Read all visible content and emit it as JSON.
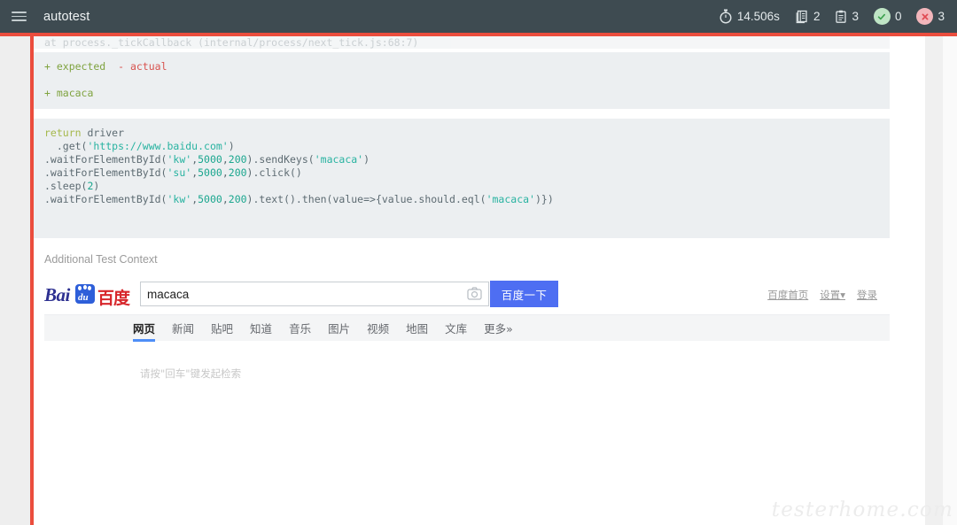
{
  "topbar": {
    "menu_icon": "hamburger-menu-icon",
    "title": "autotest",
    "stats": [
      {
        "icon": "stopwatch-icon",
        "value": "14.506s",
        "name": "duration-stat"
      },
      {
        "icon": "suites-icon",
        "value": "2",
        "name": "suites-stat"
      },
      {
        "icon": "tests-icon",
        "value": "3",
        "name": "tests-stat"
      },
      {
        "icon": "check-icon",
        "value": "0",
        "name": "passes-stat"
      },
      {
        "icon": "cross-icon",
        "value": "3",
        "name": "failures-stat"
      }
    ],
    "colors": {
      "bar_bg": "#3e4b51",
      "pass": "#bfe5c5",
      "fail": "#f3b6bb",
      "fail_rule": "#eb4d3d"
    }
  },
  "report": {
    "cut_line": "at process._tickCallback (internal/process/next_tick.js:68:7)",
    "diff_legend_added": "+ expected",
    "diff_legend_removed": "- actual",
    "diff_line": "+ macaca",
    "code": {
      "l1_kw": "return",
      "l1_rest": " driver",
      "l2_a": "  .get(",
      "l2_str": "'https://www.baidu.com'",
      "l2_b": ")",
      "l3_a": ".waitForElementById(",
      "l3_s1": "'kw'",
      "l3_c1": ",",
      "l3_n1": "5000",
      "l3_c2": ",",
      "l3_n2": "200",
      "l3_b": ").sendKeys(",
      "l3_s2": "'macaca'",
      "l3_c": ")",
      "l4_a": ".waitForElementById(",
      "l4_s1": "'su'",
      "l4_c1": ",",
      "l4_n1": "5000",
      "l4_c2": ",",
      "l4_n2": "200",
      "l4_b": ").click()",
      "l5_a": ".sleep(",
      "l5_n": "2",
      "l5_b": ")",
      "l6_a": ".waitForElementById(",
      "l6_s1": "'kw'",
      "l6_c1": ",",
      "l6_n1": "5000",
      "l6_c2": ",",
      "l6_n2": "200",
      "l6_b": ").text().then(value=>{value.should.eql(",
      "l6_s2": "'macaca'",
      "l6_c": ")})"
    },
    "context_label": "Additional Test Context"
  },
  "baidu": {
    "logo": {
      "bai": "Bai",
      "du": "du",
      "cn": "百度",
      "paw_icon": "paw-print-icon"
    },
    "search_value": "macaca",
    "search_placeholder": "",
    "camera_icon": "camera-icon",
    "search_button": "百度一下",
    "user_links": [
      "百度首页",
      "设置▾",
      "登录"
    ],
    "tabs": [
      "网页",
      "新闻",
      "贴吧",
      "知道",
      "音乐",
      "图片",
      "视频",
      "地图",
      "文库",
      "更多»"
    ],
    "active_tab_index": 0,
    "hint": "请按\"回车\"键发起检索",
    "colors": {
      "button": "#4e6ef2",
      "active_underline": "#4e8ef7",
      "logo_red": "#d7262b",
      "logo_blue": "#2e3191"
    }
  },
  "watermark": {
    "text": "testerhome.com"
  },
  "scrollbar": {
    "name": "vertical-scrollbar"
  }
}
